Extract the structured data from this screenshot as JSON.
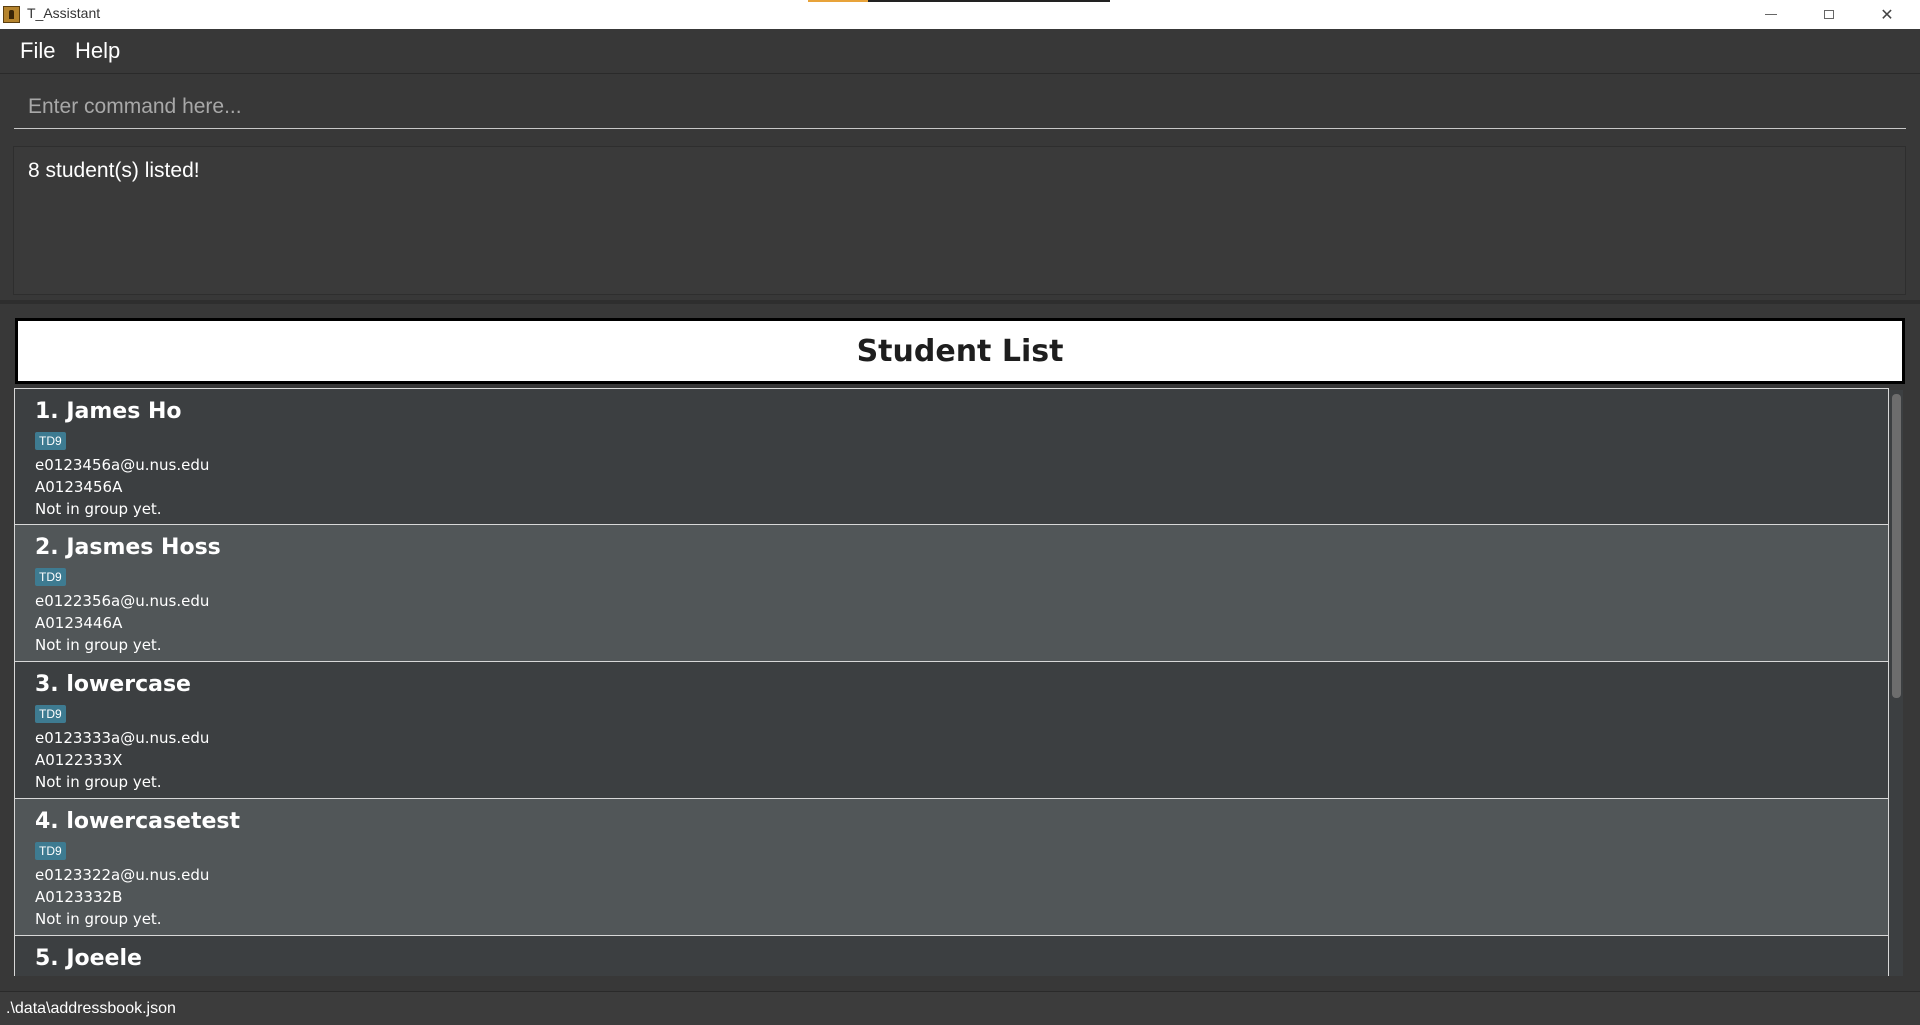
{
  "window": {
    "title": "T_Assistant"
  },
  "menu": {
    "file": "File",
    "help": "Help"
  },
  "command": {
    "placeholder": "Enter command here..."
  },
  "result": {
    "message": "8 student(s) listed!"
  },
  "student_list": {
    "header": "Student List",
    "students": [
      {
        "name": "1. James Ho",
        "tag": "TD9",
        "email": "e0123456a@u.nus.edu",
        "id": "A0123456A",
        "group": "Not in group yet."
      },
      {
        "name": "2. Jasmes Hoss",
        "tag": "TD9",
        "email": "e0122356a@u.nus.edu",
        "id": "A0123446A",
        "group": "Not in group yet."
      },
      {
        "name": "3. lowercase",
        "tag": "TD9",
        "email": "e0123333a@u.nus.edu",
        "id": "A0122333X",
        "group": "Not in group yet."
      },
      {
        "name": "4. lowercasetest",
        "tag": "TD9",
        "email": "e0123322a@u.nus.edu",
        "id": "A0123332B",
        "group": "Not in group yet."
      },
      {
        "name": "5. Joeele"
      }
    ]
  },
  "status": {
    "file_path": ".\\data\\addressbook.json"
  },
  "colors": {
    "background": "#383838",
    "card_odd": "#3c3f41",
    "card_even": "#515658",
    "tag": "#3e7b91"
  }
}
